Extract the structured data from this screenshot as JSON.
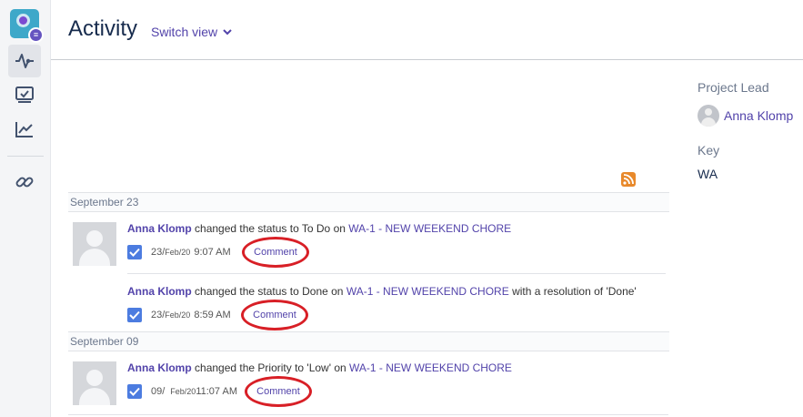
{
  "header": {
    "title": "Activity",
    "switch_view": "Switch view"
  },
  "sidebar": {
    "items": [
      "activity-icon",
      "board-icon",
      "reports-icon",
      "link-icon"
    ]
  },
  "groups": [
    {
      "date": "September 23"
    },
    {
      "date": "September 09"
    }
  ],
  "entries": [
    {
      "user": "Anna Klomp",
      "action": "changed the status to To Do on",
      "issue": "WA-1 - NEW WEEKEND CHORE",
      "suffix": "",
      "day": "23/",
      "mon": "Feb/20",
      "time": "9:07 AM",
      "comment": "Comment"
    },
    {
      "user": "Anna Klomp",
      "action": "changed the status to Done on",
      "issue": "WA-1 - NEW WEEKEND CHORE",
      "suffix": "with a resolution of 'Done'",
      "day": "23/",
      "mon": "Feb/20",
      "time": "8:59 AM",
      "comment": "Comment"
    },
    {
      "user": "Anna Klomp",
      "action": "changed the Priority to 'Low' on",
      "issue": "WA-1 - NEW WEEKEND CHORE",
      "suffix": "",
      "day": "09/",
      "mon": "Feb/20",
      "time": "11:07 AM",
      "comment": "Comment"
    }
  ],
  "project": {
    "lead_label": "Project Lead",
    "lead_name": "Anna Klomp",
    "key_label": "Key",
    "key_value": "WA"
  },
  "colors": {
    "link": "#5243aa",
    "annotation": "#d81f26",
    "rss": "#e8892b"
  }
}
